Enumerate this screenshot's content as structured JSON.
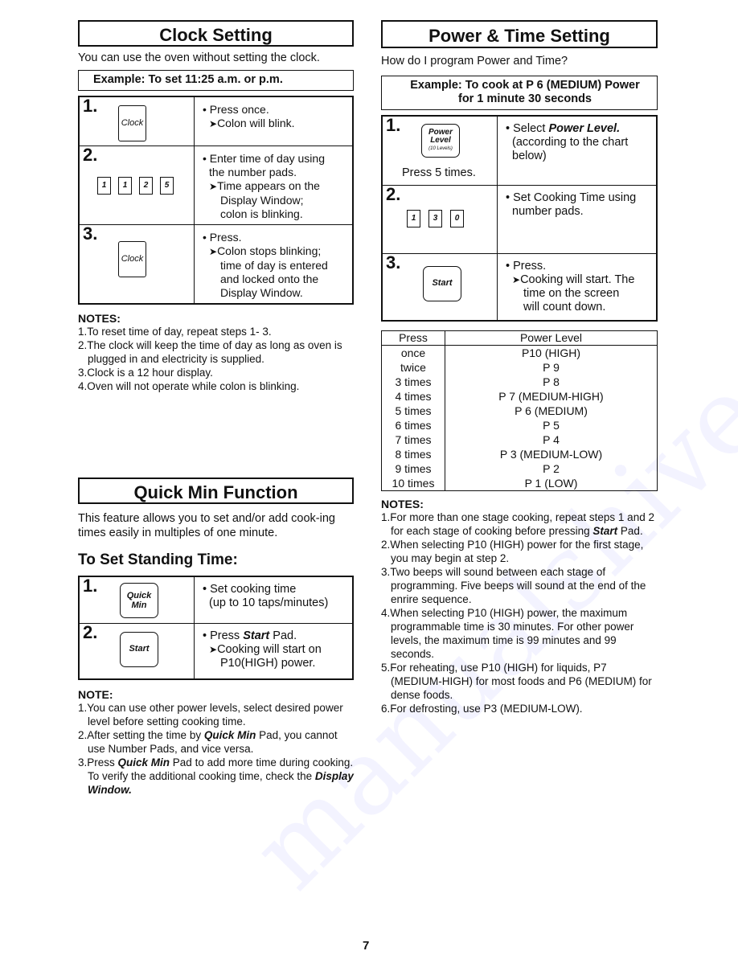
{
  "clock_setting": {
    "title": "Clock Setting",
    "intro": "You can use the oven without setting the clock.",
    "example": "Example:  To set 11:25 a.m. or p.m.",
    "steps": [
      {
        "number": "1.",
        "pad": "Clock",
        "lines": [
          "Press once.",
          "Colon will blink."
        ]
      },
      {
        "number": "2.",
        "keys": [
          "1",
          "1",
          "2",
          "5"
        ],
        "lines": [
          "Enter time of day using",
          "the number pads.",
          "Time appears on the",
          "Display Window;",
          "colon is blinking."
        ]
      },
      {
        "number": "3.",
        "pad": "Clock",
        "lines": [
          "Press.",
          "Colon stops blinking;",
          "time of day is entered",
          "and locked onto the",
          "Display Window."
        ]
      }
    ],
    "notes_title": "NOTES:",
    "notes": [
      "1.To reset time of day, repeat steps 1- 3.",
      "2.The clock will keep the time of day as long as oven is plugged in and electricity is supplied.",
      "3.Clock is a 12 hour display.",
      "4.Oven will not operate while colon is blinking."
    ]
  },
  "quick_min": {
    "title": "Quick Min Function",
    "intro": "This feature allows you to set and/or add cook-ing times easily in multiples of one minute.",
    "subhead": "To Set Standing Time:",
    "steps": [
      {
        "number": "1.",
        "pad_line1": "Quick",
        "pad_line2": "Min",
        "lines": [
          "Set cooking time",
          "(up to 10 taps/minutes)"
        ]
      },
      {
        "number": "2.",
        "pad": "Start",
        "line1_pre": "Press ",
        "line1_bold": "Start",
        "line1_post": " Pad.",
        "lines": [
          "Cooking will start on",
          "P10(HIGH) power."
        ]
      }
    ],
    "notes_title": "NOTE:",
    "notes": {
      "n1": "1.You can use other power levels, select desired power level before setting cooking time.",
      "n2_pre": "2.After setting the time by ",
      "n2_bold": "Quick Min",
      "n2_post": " Pad, you cannot use Number Pads, and vice versa.",
      "n3_pre": "3.Press ",
      "n3_bold": "Quick Min",
      "n3_mid": " Pad to add more time during cooking. To verify the additional cooking time, check the ",
      "n3_bold2": "Display Window."
    }
  },
  "power_time": {
    "title": "Power & Time Setting",
    "intro": "How do I program Power and Time?",
    "example_line1": "Example:  To cook at P 6 (MEDIUM) Power",
    "example_line2": "for 1 minute 30 seconds",
    "steps": [
      {
        "number": "1.",
        "pad_line1": "Power",
        "pad_line2": "Level",
        "pad_line3": "(10 Levels)",
        "caption": "Press 5 times.",
        "line1_pre": "Select ",
        "line1_bold": "Power Level.",
        "lines": [
          "(according to the chart",
          "below)"
        ]
      },
      {
        "number": "2.",
        "keys": [
          "1",
          "3",
          "0"
        ],
        "lines": [
          "Set Cooking Time using",
          "number pads."
        ]
      },
      {
        "number": "3.",
        "pad": "Start",
        "lines": [
          "Press.",
          "Cooking will start. The",
          "time on the screen",
          "will count down."
        ]
      }
    ],
    "table": {
      "headers": [
        "Press",
        "Power Level"
      ],
      "rows": [
        [
          "once",
          "P10 (HIGH)"
        ],
        [
          "twice",
          "P 9"
        ],
        [
          "3 times",
          "P 8"
        ],
        [
          "4 times",
          "P 7 (MEDIUM-HIGH)"
        ],
        [
          "5 times",
          "P 6 (MEDIUM)"
        ],
        [
          "6 times",
          "P 5"
        ],
        [
          "7 times",
          "P 4"
        ],
        [
          "8 times",
          "P 3 (MEDIUM-LOW)"
        ],
        [
          "9 times",
          "P 2"
        ],
        [
          "10 times",
          "P 1 (LOW)"
        ]
      ]
    },
    "notes_title": "NOTES:",
    "notes": {
      "n1_pre": "1.For more than one stage cooking, repeat steps 1 and 2 for each stage of cooking before pressing ",
      "n1_bold": "Start",
      "n1_post": " Pad.",
      "n2": "2.When selecting P10 (HIGH) power for the first stage, you may begin at step 2.",
      "n3": "3.Two beeps will sound between each stage of programming. Five beeps will sound at the end of the enrire sequence.",
      "n4": "4.When selecting P10 (HIGH) power, the maximum programmable time is 30 minutes. For other power levels, the maximum time is 99 minutes and 99 seconds.",
      "n5": "5.For reheating, use P10 (HIGH) for liquids, P7 (MEDIUM-HIGH) for most foods and P6 (MEDIUM) for dense foods.",
      "n6": "6.For defrosting, use P3 (MEDIUM-LOW)."
    }
  },
  "page_number": "7",
  "watermark": "manualshive.com"
}
